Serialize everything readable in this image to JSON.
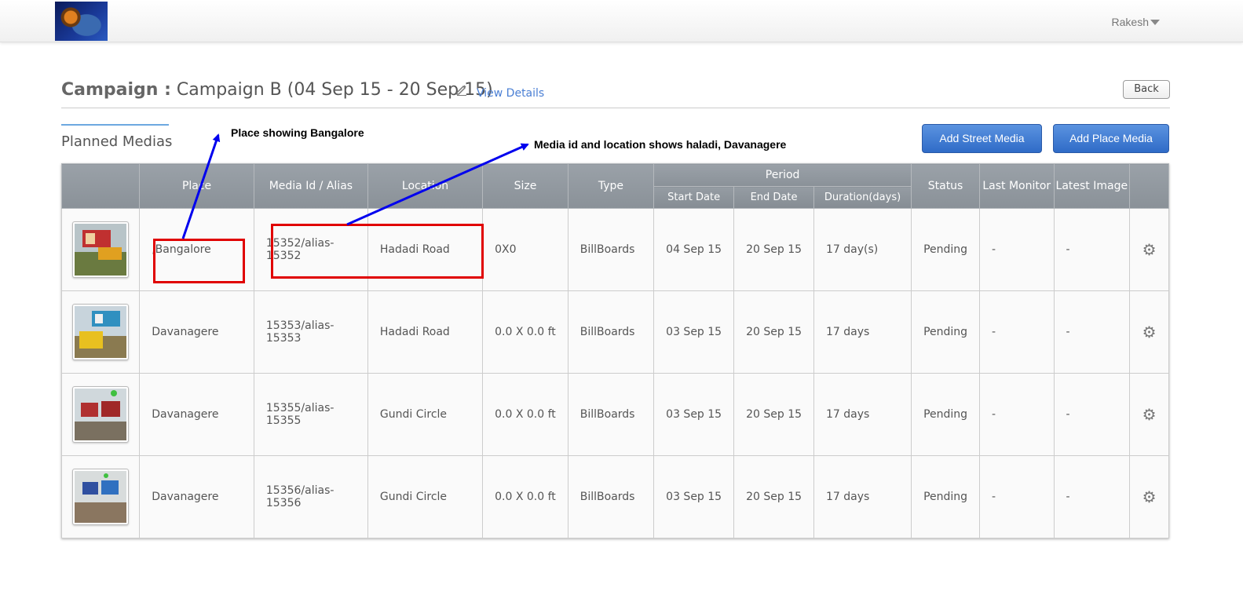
{
  "header": {
    "user_name": "Rakesh"
  },
  "campaign": {
    "label": "Campaign :",
    "name": "Campaign B (04 Sep 15 - 20 Sep 15)",
    "view_details": "View Details",
    "back": "Back"
  },
  "tabs": {
    "planned": "Planned Medias"
  },
  "actions": {
    "add_street": "Add Street Media",
    "add_place": "Add Place Media"
  },
  "table": {
    "headers": {
      "place": "Place",
      "media_id": "Media Id / Alias",
      "location": "Location",
      "size": "Size",
      "type": "Type",
      "period": "Period",
      "start": "Start Date",
      "end": "End Date",
      "duration": "Duration(days)",
      "status": "Status",
      "last_monitor": "Last Monitor",
      "latest_image": "Latest Image"
    },
    "rows": [
      {
        "place": ",Bangalore",
        "media_id_1": "15352/alias-",
        "media_id_2": "15352",
        "location": "Hadadi Road",
        "size": "0X0",
        "type": "BillBoards",
        "start": "04 Sep 15",
        "end": "20 Sep 15",
        "duration": "17 day(s)",
        "status": "Pending",
        "last_monitor": "-",
        "latest_image": "-"
      },
      {
        "place": "Davanagere",
        "media_id_1": "15353/alias-",
        "media_id_2": "15353",
        "location": "Hadadi Road",
        "size": "0.0 X 0.0 ft",
        "type": "BillBoards",
        "start": "03 Sep 15",
        "end": "20 Sep 15",
        "duration": "17 days",
        "status": "Pending",
        "last_monitor": "-",
        "latest_image": "-"
      },
      {
        "place": "Davanagere",
        "media_id_1": "15355/alias-",
        "media_id_2": "15355",
        "location": "Gundi Circle",
        "size": "0.0 X 0.0 ft",
        "type": "BillBoards",
        "start": "03 Sep 15",
        "end": "20 Sep 15",
        "duration": "17 days",
        "status": "Pending",
        "last_monitor": "-",
        "latest_image": "-"
      },
      {
        "place": "Davanagere",
        "media_id_1": "15356/alias-",
        "media_id_2": "15356",
        "location": "Gundi Circle",
        "size": "0.0 X 0.0 ft",
        "type": "BillBoards",
        "start": "03 Sep 15",
        "end": "20 Sep 15",
        "duration": "17 days",
        "status": "Pending",
        "last_monitor": "-",
        "latest_image": "-"
      }
    ]
  },
  "annotations": {
    "place_note": "Place showing Bangalore",
    "media_note": "Media id and location shows haladi, Davanagere"
  },
  "colors": {
    "accent": "#4a7fd4",
    "annotation_box": "#e00000",
    "annotation_arrow": "#0000ee"
  }
}
